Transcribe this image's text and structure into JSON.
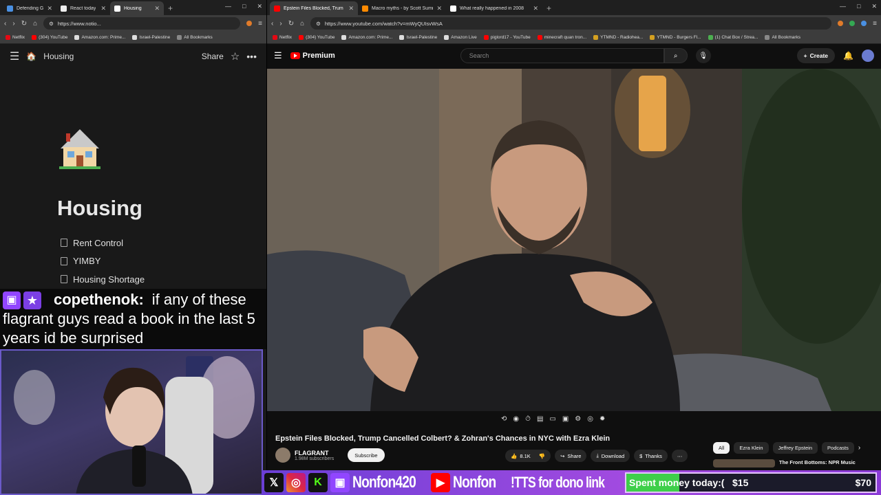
{
  "left_browser": {
    "tabs": [
      {
        "title": "Defending G",
        "color": "#4a90e2",
        "active": false
      },
      {
        "title": "React today",
        "color": "#ffffff",
        "active": false
      },
      {
        "title": "Housing",
        "color": "#ffffff",
        "active": true
      }
    ],
    "url": "https://www.notio...",
    "bookmarks": [
      "Netflix",
      "(304) YouTube",
      "Amazon.com: Prime...",
      "Israel-Palestine",
      "All Bookmarks"
    ]
  },
  "notion": {
    "breadcrumb_title": "Housing",
    "share_label": "Share",
    "page_title": "Housing",
    "items": [
      "Rent Control",
      "YIMBY",
      "Housing Shortage"
    ]
  },
  "chat": {
    "username": "copethenok:",
    "message": "if any of these flagrant guys read a book in the last 5 years id be surprised"
  },
  "right_browser": {
    "tabs": [
      {
        "title": "Epstein Files Blocked, Trum",
        "color": "#ff0000",
        "active": true
      },
      {
        "title": "Macro myths - by Scott Sumne",
        "color": "#ff8a00",
        "active": false
      },
      {
        "title": "What really happened in 2008",
        "color": "#ffffff",
        "active": false
      }
    ],
    "url": "https://www.youtube.com/watch?v=mWyQUIsvWsA",
    "bookmarks": [
      "Netflix",
      "(304) YouTube",
      "Amazon.com: Prime...",
      "Israel-Palestine",
      "Amazon Live",
      "piglord17 - YouTube",
      "minecraft quan tron...",
      "YTMND - Radiohea...",
      "YTMND - Burgers Fl...",
      "(1) Chat Box / Strea...",
      "All Bookmarks"
    ]
  },
  "youtube": {
    "logo_text": "Premium",
    "search_placeholder": "Search",
    "create_label": "Create",
    "video_title": "Epstein Files Blocked, Trump Cancelled Colbert? & Zohran's Chances in NYC with Ezra Klein",
    "channel_name": "FLAGRANT",
    "channel_subs": "1.98M subscribers",
    "subscribe_label": "Subscribe",
    "likes": "8.1K",
    "share_label": "Share",
    "download_label": "Download",
    "thanks_label": "Thanks",
    "chips": [
      "All",
      "Ezra Klein",
      "Jeffrey Epstein",
      "Podcasts"
    ],
    "rec_title": "The Front Bottoms: NPR Music"
  },
  "overlay": {
    "twitch_name": "Nonfon420",
    "youtube_name": "Nonfon",
    "tts_label": "!TTS for dono link",
    "goal_label": "Spent money today:(",
    "goal_current": "$15",
    "goal_target": "$70",
    "goal_progress": 0.214
  }
}
